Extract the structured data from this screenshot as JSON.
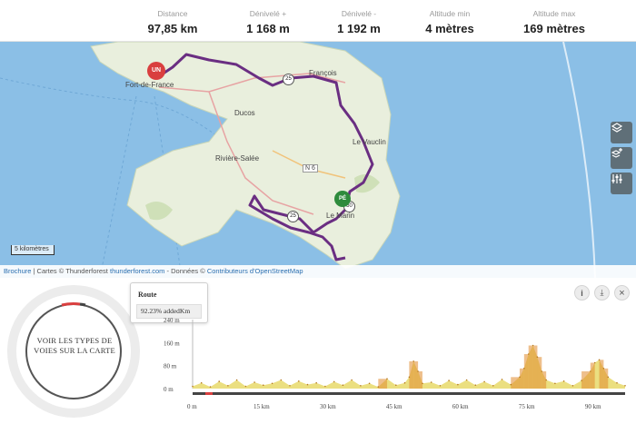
{
  "stats": [
    {
      "label": "Distance",
      "value": "97,85 km"
    },
    {
      "label": "Dénivelé +",
      "value": "1 168 m"
    },
    {
      "label": "Dénivelé -",
      "value": "1 192 m"
    },
    {
      "label": "Altitude min",
      "value": "4 mètres"
    },
    {
      "label": "Altitude max",
      "value": "169 mètres"
    }
  ],
  "map": {
    "places": {
      "fort_de_france": "Fort-de-France",
      "francois": "François",
      "ducos": "Ducos",
      "vauclin": "Le Vauclin",
      "riviere_salee": "Rivière-Salée",
      "le_marin": "Le Marin"
    },
    "road_n6": "N 6",
    "markers": {
      "start": "UN",
      "end": "PÉ"
    },
    "km_markers": [
      "25",
      "25",
      "50"
    ],
    "scale": "5 kilomètres",
    "colors": {
      "route": "#6a2e82",
      "sea": "#8bbfe6",
      "land": "#e9efdd",
      "start": "#d93f3f",
      "end": "#2e8b3c"
    }
  },
  "tools": {
    "layers_icon": "layers-icon",
    "add_layer_icon": "add-layer-icon",
    "settings_icon": "sliders-icon"
  },
  "attribution": {
    "brochure": "Brochure",
    "maps": " | Cartes © Thunderforest ",
    "thunderforest": "thunderforest.com",
    "data": " - Données © ",
    "osm": "Contributeurs d'OpenStreetMap"
  },
  "donut": {
    "text": "VOIR LES TYPES DE VOIES SUR LA CARTE"
  },
  "tooltip": {
    "title": "Route",
    "value": "92.23% addedKm"
  },
  "buttons": {
    "info": "i",
    "download": "⤓",
    "close": "×"
  },
  "chart_data": {
    "type": "area",
    "ylabels": [
      "240 m",
      "160 m",
      "80 m",
      "0 m"
    ],
    "yvalues": [
      240,
      160,
      80,
      0
    ],
    "xlabels": [
      "0 m",
      "15 km",
      "30 km",
      "45 km",
      "60 km",
      "75 km",
      "90 km"
    ],
    "xvalues": [
      0,
      15,
      30,
      45,
      60,
      75,
      90
    ],
    "xlim": [
      0,
      97.85
    ],
    "ylim": [
      0,
      240
    ],
    "x": [
      0,
      2,
      4,
      6,
      8,
      10,
      12,
      14,
      16,
      18,
      20,
      22,
      24,
      26,
      28,
      30,
      32,
      34,
      36,
      38,
      40,
      42,
      44,
      46,
      48,
      49,
      50,
      51,
      52,
      54,
      56,
      58,
      60,
      62,
      64,
      66,
      68,
      70,
      72,
      74,
      75,
      76,
      77,
      78,
      79,
      80,
      82,
      84,
      86,
      88,
      90,
      91,
      92,
      93,
      94,
      96,
      97.85
    ],
    "y": [
      8,
      20,
      6,
      25,
      10,
      30,
      8,
      22,
      12,
      18,
      30,
      10,
      26,
      14,
      20,
      8,
      24,
      12,
      30,
      10,
      18,
      6,
      34,
      12,
      20,
      40,
      95,
      60,
      18,
      22,
      10,
      28,
      14,
      30,
      12,
      24,
      10,
      32,
      14,
      40,
      70,
      120,
      150,
      110,
      60,
      30,
      18,
      26,
      10,
      28,
      60,
      90,
      100,
      70,
      40,
      20,
      10
    ]
  }
}
